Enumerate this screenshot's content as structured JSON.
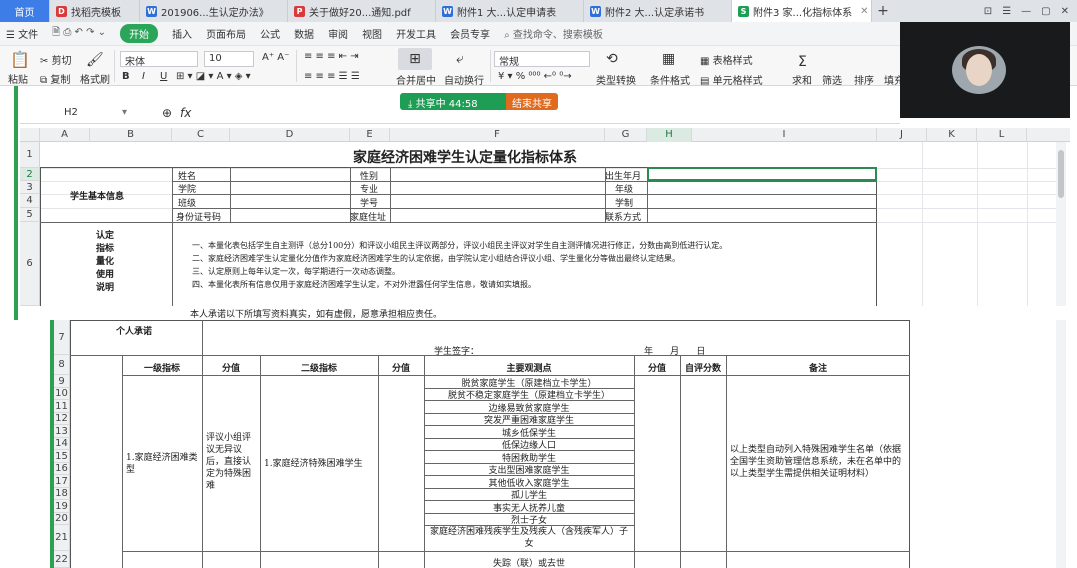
{
  "tabs": [
    {
      "label": "首页",
      "kind": "home"
    },
    {
      "label": "找稻壳模板",
      "icon": "D",
      "color": "#d93a3a"
    },
    {
      "label": "201906...生认定办法》",
      "icon": "W",
      "color": "#2f6fd8"
    },
    {
      "label": "关于做好20...通知.pdf",
      "icon": "P",
      "color": "#d93a3a"
    },
    {
      "label": "附件1 大...认定申请表",
      "icon": "W",
      "color": "#2f6fd8"
    },
    {
      "label": "附件2 大...认定承诺书",
      "icon": "W",
      "color": "#2f6fd8"
    },
    {
      "label": "附件3 家...化指标体系",
      "icon": "S",
      "color": "#1e9d55",
      "active": true
    }
  ],
  "tab_plus": "+",
  "window_buttons": [
    "⊡",
    "☰",
    "—",
    "▢",
    "✕"
  ],
  "menu": {
    "file": "文件",
    "items": [
      "开始",
      "插入",
      "页面布局",
      "公式",
      "数据",
      "审阅",
      "视图",
      "开发工具",
      "会员专享"
    ],
    "search": "查找命令、搜索模板"
  },
  "toolbar": {
    "paste": "粘贴",
    "cut": "剪切",
    "copy": "复制",
    "format_painter": "格式刷",
    "font_name": "宋体",
    "font_size": "10",
    "bold": "B",
    "italic": "I",
    "underline": "U",
    "merge": "合并居中",
    "wrap": "自动换行",
    "number_format": "常规",
    "convert": "类型转换",
    "cond_format": "条件格式",
    "table_style": "表格样式",
    "cell_style": "单元格样式",
    "sum": "求和",
    "filter": "筛选",
    "sort": "排序",
    "fill": "填充"
  },
  "formula": {
    "cell_ref": "H2",
    "fx": "fx"
  },
  "share": {
    "timer": "共享中 44:58",
    "end": "结束共享"
  },
  "columns": [
    "A",
    "B",
    "C",
    "D",
    "E",
    "F",
    "G",
    "H",
    "I",
    "J",
    "K",
    "L"
  ],
  "selected_column": "H",
  "rows_upper": [
    "1",
    "2",
    "3",
    "4",
    "5",
    "6"
  ],
  "rows_lower": [
    "7",
    "8",
    "9",
    "10",
    "11",
    "12",
    "13",
    "14",
    "15",
    "16",
    "17",
    "18",
    "19",
    "20",
    "21",
    "22"
  ],
  "sheet": {
    "title": "家庭经济困难学生认定量化指标体系",
    "basic_info": "学生基本信息",
    "r2": {
      "name": "姓名",
      "gender": "性别",
      "birth": "出生年月"
    },
    "r3": {
      "college": "学院",
      "major": "专业",
      "grade": "年级"
    },
    "r4": {
      "class": "班级",
      "student_id": "学号",
      "system": "学制"
    },
    "r5": {
      "id_no": "身份证号码",
      "address": "家庭住址",
      "contact": "联系方式"
    },
    "explain_label": [
      "认定",
      "指标",
      "量化",
      "使用",
      "说明"
    ],
    "explain_lines": [
      "一、本量化表包括学生自主测评（总分100分）和评议小组民主评议两部分，评议小组民主评议对学生自主测评情况进行修正，分数由高到低进行认定。",
      "二、家庭经济困难学生认定量化分值作为家庭经济困难学生的认定依据，由学院认定小组结合评议小组、学生量化分等做出最终认定结果。",
      "三、认定原则上每年认定一次，每学期进行一次动态调整。",
      "四、本量化表所有信息仅用于家庭经济困难学生认定，不对外泄露任何学生信息，敬请如实填报。"
    ],
    "promise_text": "本人承诺以下所填写资料真实，如有虚假，愿意承担相应责任。",
    "promise_label": "个人承诺",
    "signature": "学生签字：",
    "date": "年      月      日",
    "headers": {
      "level1": "一级指标",
      "score1": "分值",
      "level2": "二级指标",
      "score2": "分值",
      "points": "主要观测点",
      "score3": "分值",
      "self_score": "自评分数",
      "remark": "备注"
    },
    "level1_item": "1.家庭经济困难类型",
    "score1_text": "评议小组评议无异议后，直接认定为特殊困难",
    "level2_item": "1.家庭经济特殊困难学生",
    "points": [
      "脱贫家庭学生（原建档立卡学生）",
      "脱贫不稳定家庭学生（原建档立卡学生）",
      "边缘易致贫家庭学生",
      "突发严重困难家庭学生",
      "城乡低保学生",
      "低保边缘人口",
      "特困救助学生",
      "支出型困难家庭学生",
      "其他低收入家庭学生",
      "孤儿学生",
      "事实无人抚养儿童",
      "烈士子女",
      "家庭经济困难残疾学生及残疾人（含残疾军人）子女"
    ],
    "remark_text": "以上类型自动列入特殊困难学生名单（依据全国学生资助管理信息系统，未在名单中的以上类型学生需提供相关证明材料）",
    "row22_point": "失踪（联）或去世"
  }
}
